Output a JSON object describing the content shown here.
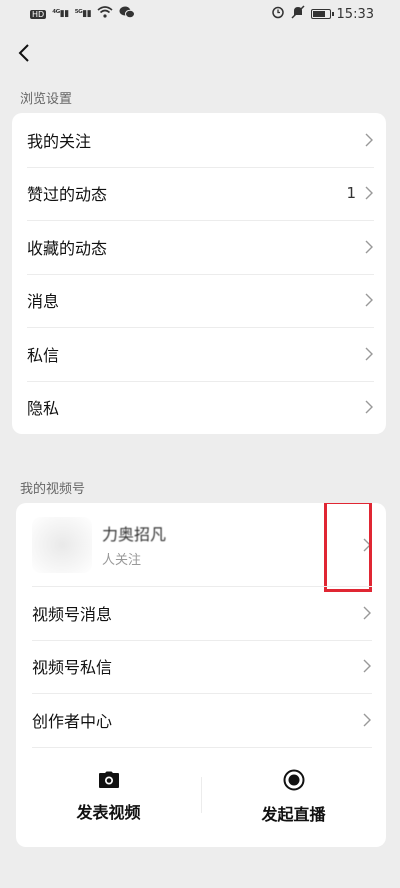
{
  "status_bar": {
    "left_text": "HD 2 4G 5G",
    "time": "15:33"
  },
  "section_browse": {
    "title": "浏览设置",
    "items": [
      {
        "label": "我的关注",
        "count": ""
      },
      {
        "label": "赞过的动态",
        "count": "1"
      },
      {
        "label": "收藏的动态",
        "count": ""
      },
      {
        "label": "消息",
        "count": ""
      },
      {
        "label": "私信",
        "count": ""
      },
      {
        "label": "隐私",
        "count": ""
      }
    ]
  },
  "section_channels": {
    "title": "我的视频号",
    "profile": {
      "name": "力奥招凡",
      "sub": "人关注"
    },
    "items": [
      {
        "label": "视频号消息"
      },
      {
        "label": "视频号私信"
      },
      {
        "label": "创作者中心"
      }
    ],
    "actions": [
      {
        "label": "发表视频",
        "icon": "camera-icon"
      },
      {
        "label": "发起直播",
        "icon": "live-icon"
      }
    ]
  },
  "colors": {
    "highlight": "#e02633",
    "background": "#ededed"
  }
}
